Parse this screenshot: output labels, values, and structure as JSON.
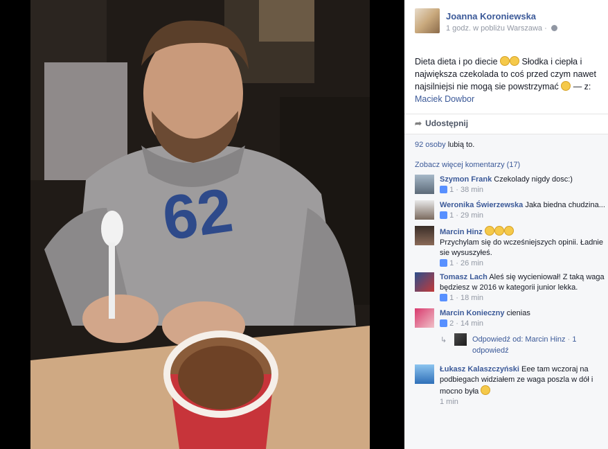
{
  "post": {
    "author": "Joanna Koroniewska",
    "meta_time": "1 godz.",
    "meta_location": "w pobliżu Warszawa",
    "meta_sep": "·",
    "caption_part1": "Dieta dieta i po diecie",
    "caption_part2": "Słodka i ciepła i największa czekolada to coś przed czym nawet najsilniejsi nie mogą sie powstrzymać",
    "caption_with": "— z:",
    "tagged": "Maciek Dowbor"
  },
  "actions": {
    "share_label": "Udostępnij"
  },
  "likes": {
    "count_text": "92 osoby",
    "suffix": "lubią to."
  },
  "comments": {
    "more_label": "Zobacz więcej komentarzy (17)",
    "items": [
      {
        "name": "Szymon Frank",
        "text": "Czekolady nigdy dosc:)",
        "likes": "1",
        "time": "38 min"
      },
      {
        "name": "Weronika Świerzewska",
        "text": "Jaka biedna chudzina...",
        "likes": "1",
        "time": "29 min"
      },
      {
        "name": "Marcin Hinz",
        "text": "Przychylam się do wcześniejszych opinii. Ładnie sie wysuszyłeś.",
        "likes": "1",
        "time": "26 min"
      },
      {
        "name": "Tomasz Lach",
        "text": "Aleś się wycieniował! Z taką waga będziesz w 2016 w kategorii junior lekka.",
        "likes": "1",
        "time": "18 min"
      },
      {
        "name": "Marcin Konieczny",
        "text": "cienias",
        "likes": "2",
        "time": "14 min"
      },
      {
        "name": "Łukasz Kalaszczyński",
        "text": "Eee tam wczoraj na podbiegach widziałem ze waga poszla w dół i mocno była",
        "likes": "",
        "time": "1 min"
      }
    ],
    "reply": {
      "text": "Odpowiedź od: Marcin Hinz",
      "sep": "·",
      "count": "1 odpowiedź"
    },
    "middot": "·"
  },
  "colors": {
    "link": "#3b5998",
    "meta": "#9197a3",
    "like_icon": "#5890ff"
  }
}
